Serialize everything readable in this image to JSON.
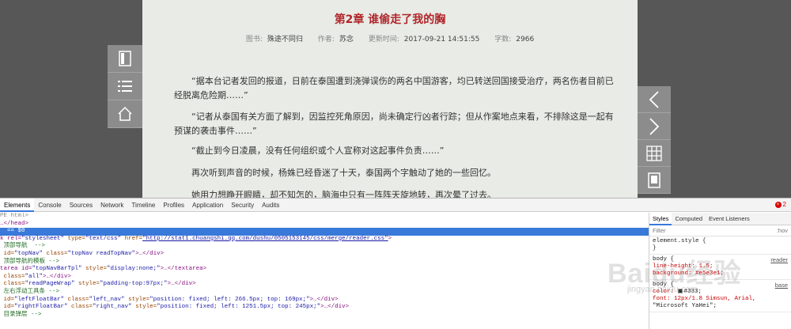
{
  "reader": {
    "chapter_title": "第2章 谁偷走了我的胸",
    "meta": {
      "book_label": "图书:",
      "book_value": "殊途不同归",
      "author_label": "作者:",
      "author_value": "苏念",
      "updated_label": "更新时间:",
      "updated_value": "2017-09-21 14:51:55",
      "words_label": "字数:",
      "words_value": "2966"
    },
    "paragraphs": [
      "“据本台记者发回的报道，日前在泰国遭到浇弹误伤的两名中国游客，均已转送回国接受治疗，两名伤者目前已经脱离危险期……”",
      "“记者从泰国有关方面了解到，因监控死角原因，尚未确定行凶者行踪；但从作案地点来看，不排除这是一起有预谋的袭击事件……”",
      "“截止到今日凌晨，没有任何组织或个人宣称对这起事件负责……”",
      "再次听到声音的时候，杨姝已经昏迷了十天，泰国两个字触动了她的一些回忆。",
      "她用力想睁开眼睛，却不知怎的，脑海中只有一阵阵天旋地转，再次晕了过去。"
    ],
    "left_toolbar": [
      {
        "icon": "book-icon"
      },
      {
        "icon": "list-icon"
      },
      {
        "icon": "home-icon"
      }
    ],
    "right_toolbar": [
      {
        "icon": "chevron-left-icon"
      },
      {
        "icon": "chevron-right-icon"
      },
      {
        "icon": "grid-icon"
      },
      {
        "icon": "phone-icon"
      }
    ]
  },
  "devtools": {
    "tabs": [
      "Elements",
      "Console",
      "Sources",
      "Network",
      "Timeline",
      "Profiles",
      "Application",
      "Security",
      "Audits"
    ],
    "active_tab": "Elements",
    "error_count": "2",
    "dom_lines": {
      "l1": "PE html>",
      "l2": "…</head>",
      "l3": "  == $0",
      "l4_a": "k rel=",
      "l4_b": "\"stylesheet\"",
      "l4_c": " type=",
      "l4_d": "\"text/css\"",
      "l4_e": " href=",
      "l4_f": "\"http://stat1.chuangshi.qq.com/dushu/0505153145/css/merge/reader.css\"",
      "l4_g": ">",
      "l5": " 顶部导航  -->",
      "l6_a": " id=",
      "l6_b": "\"topNav\"",
      "l6_c": " class=",
      "l6_d": "\"topNav readTopNav\"",
      "l6_e": ">…</div>",
      "l7": " 顶部导航的模板 -->",
      "l8_a": "tarea id=",
      "l8_b": "\"topNavBarTpl\"",
      "l8_c": " style=",
      "l8_d": "\"display:none;\"",
      "l8_e": ">…</textarea>",
      "l9_a": " class=",
      "l9_b": "\"all\"",
      "l9_c": ">…</div>",
      "l10_a": " class=",
      "l10_b": "\"readPageWrap\"",
      "l10_c": " style=",
      "l10_d": "\"padding-top:97px;\"",
      "l10_e": ">…</div>",
      "l11": " 左右浮动工具条 -->",
      "l12_a": " id=",
      "l12_b": "\"leftFloatBar\"",
      "l12_c": " class=",
      "l12_d": "\"left_nav\"",
      "l12_e": " style=",
      "l12_f": "\"position: fixed; left: 266.5px; top: 169px;\"",
      "l12_g": ">…</div>",
      "l13_a": " id=",
      "l13_b": "\"rightFloatBar\"",
      "l13_c": " class=",
      "l13_d": "\"right_nav\"",
      "l13_e": " style=",
      "l13_f": "\"position: fixed; left: 1251.5px; top: 245px;\"",
      "l13_g": ">…</div>",
      "l14": " 目录弹层 -->"
    },
    "styles": {
      "tabs": [
        "Styles",
        "Computed",
        "Event Listeners"
      ],
      "active_tab": "Styles",
      "filter_placeholder": "Filter",
      "filter_hov": ":hov",
      "rule1_selector": "element.style {",
      "rule1_close": "}",
      "rule2_selector": "body {",
      "rule2_src": "reader",
      "rule2_p1": "    line-height: 1.5;",
      "rule2_p2": "    background: #e5e3e1;",
      "rule3_selector": "body {",
      "rule3_src": "base",
      "rule3_p1_name": "    color:",
      "rule3_p1_val": "#333;",
      "rule3_p2": "    font: 12px/1.8 Simsun, Arial,",
      "rule3_p3": "        \"Microsoft YaHei\";"
    }
  },
  "watermark": {
    "text": "Baidu经验",
    "url": "jingyan.baidu.com"
  }
}
